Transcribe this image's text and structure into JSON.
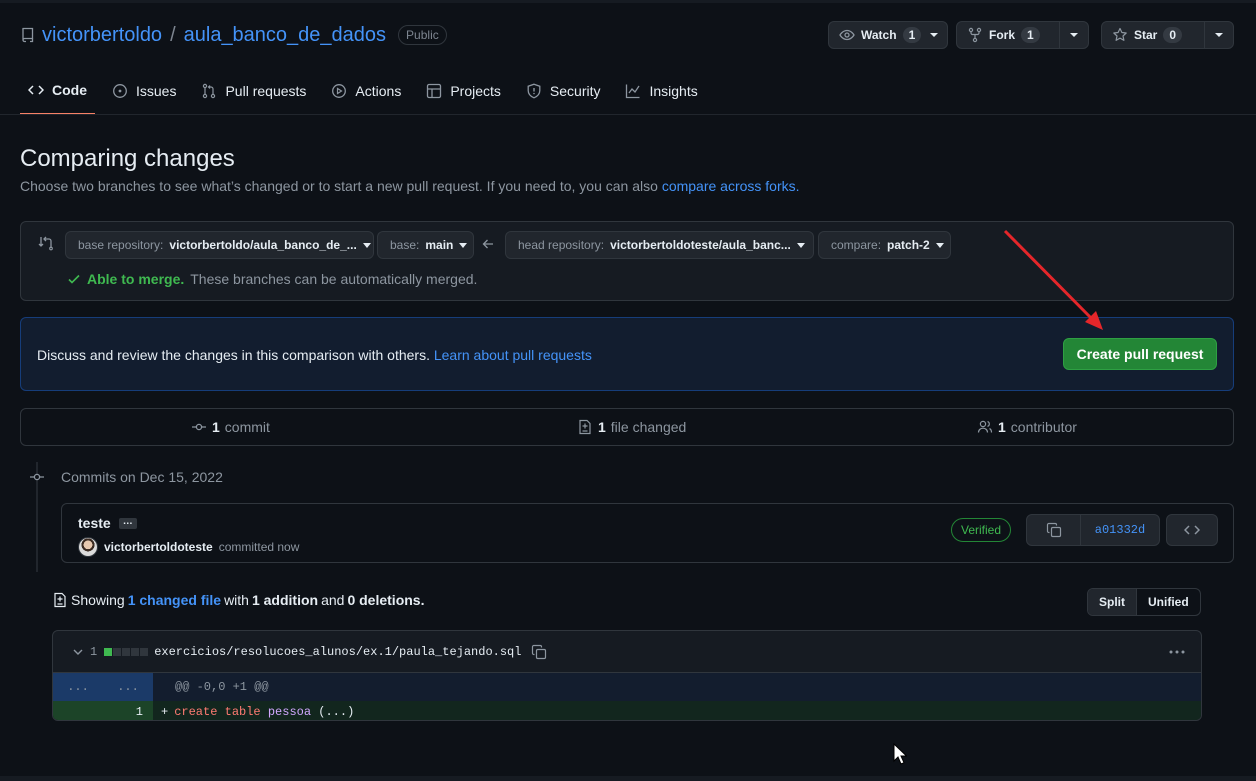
{
  "header": {
    "owner": "victorbertoldo",
    "separator": "/",
    "repo": "aula_banco_de_dados",
    "visibility": "Public",
    "watch_label": "Watch",
    "watch_count": "1",
    "fork_label": "Fork",
    "fork_count": "1",
    "star_label": "Star",
    "star_count": "0"
  },
  "tabs": [
    {
      "label": "Code"
    },
    {
      "label": "Issues"
    },
    {
      "label": "Pull requests"
    },
    {
      "label": "Actions"
    },
    {
      "label": "Projects"
    },
    {
      "label": "Security"
    },
    {
      "label": "Insights"
    }
  ],
  "page": {
    "title": "Comparing changes",
    "subtitle": "Choose two branches to see what’s changed or to start a new pull request. If you need to, you can also ",
    "subtitle_link": "compare across forks."
  },
  "compare": {
    "base_repo_prefix": "base repository:",
    "base_repo_value": "victorbertoldo/aula_banco_de_...",
    "base_prefix": "base:",
    "base_value": "main",
    "head_repo_prefix": "head repository:",
    "head_repo_value": "victorbertoldoteste/aula_banc...",
    "compare_prefix": "compare:",
    "compare_value": "patch-2",
    "merge_status": "Able to merge.",
    "merge_detail": "These branches can be automatically merged."
  },
  "discuss": {
    "text": "Discuss and review the changes in this comparison with others.",
    "link": "Learn about pull requests",
    "button": "Create pull request"
  },
  "stats": {
    "commits_count": "1",
    "commits_label": "commit",
    "files_count": "1",
    "files_label": "file changed",
    "contributors_count": "1",
    "contributors_label": "contributor"
  },
  "commits": {
    "date_header": "Commits on Dec 15, 2022",
    "message": "teste",
    "ellipsis": "…",
    "author": "victorbertoldoteste",
    "action": "committed now",
    "verified": "Verified",
    "sha": "a01332d"
  },
  "summary": {
    "showing": "Showing",
    "changed_files": "1 changed file",
    "with": "with",
    "additions": "1 addition",
    "and": "and",
    "deletions": "0 deletions.",
    "split": "Split",
    "unified": "Unified"
  },
  "diff": {
    "change_count": "1",
    "path": "exercicios/resolucoes_alunos/ex.1/paula_tejando.sql",
    "hunk_left": "...",
    "hunk_right": "...",
    "hunk_header": "@@ -0,0 +1 @@",
    "line_number": "1",
    "line_plus": "+",
    "kw1": "create",
    "kw2": "table",
    "ident": "pessoa",
    "rest": "(...)"
  },
  "colors": {
    "background": "#0d1117",
    "accent_link": "#4493f8",
    "primary_button": "#238636",
    "active_tab_underline": "#f78166",
    "annotation_arrow": "#e5262a"
  }
}
